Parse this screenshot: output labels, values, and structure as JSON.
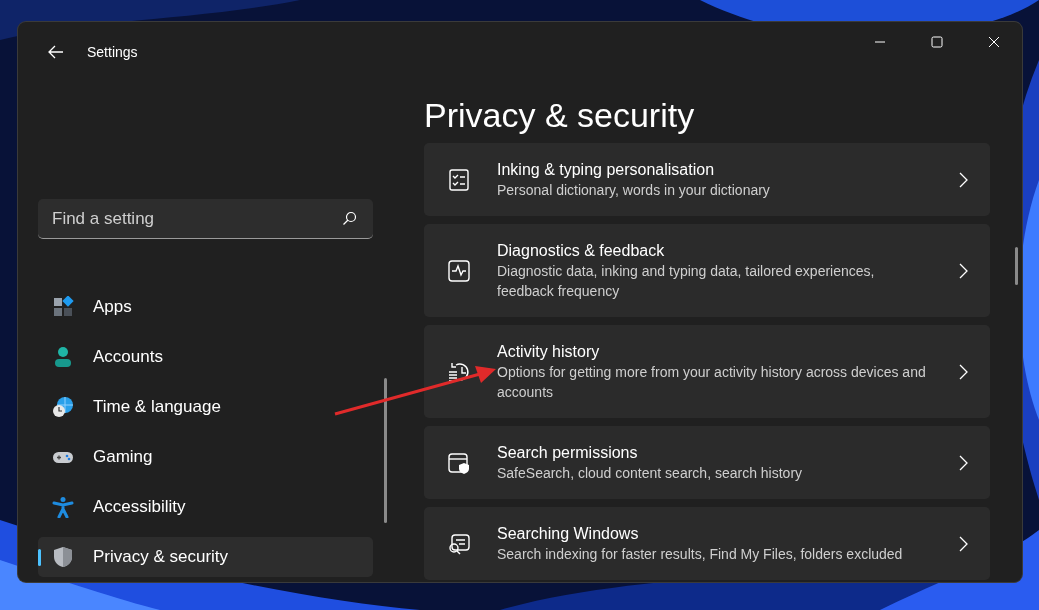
{
  "window": {
    "title": "Settings"
  },
  "search": {
    "placeholder": "Find a setting"
  },
  "sidebar": {
    "items": [
      {
        "label": "Apps",
        "selected": false
      },
      {
        "label": "Accounts",
        "selected": false
      },
      {
        "label": "Time & language",
        "selected": false
      },
      {
        "label": "Gaming",
        "selected": false
      },
      {
        "label": "Accessibility",
        "selected": false
      },
      {
        "label": "Privacy & security",
        "selected": true
      }
    ]
  },
  "page": {
    "title": "Privacy & security"
  },
  "cards": [
    {
      "title": "Inking & typing personalisation",
      "description": "Personal dictionary, words in your dictionary"
    },
    {
      "title": "Diagnostics & feedback",
      "description": "Diagnostic data, inking and typing data, tailored experiences, feedback frequency"
    },
    {
      "title": "Activity history",
      "description": "Options for getting more from your activity history across devices and accounts"
    },
    {
      "title": "Search permissions",
      "description": "SafeSearch, cloud content search, search history"
    },
    {
      "title": "Searching Windows",
      "description": "Search indexing for faster results, Find My Files, folders excluded"
    }
  ]
}
